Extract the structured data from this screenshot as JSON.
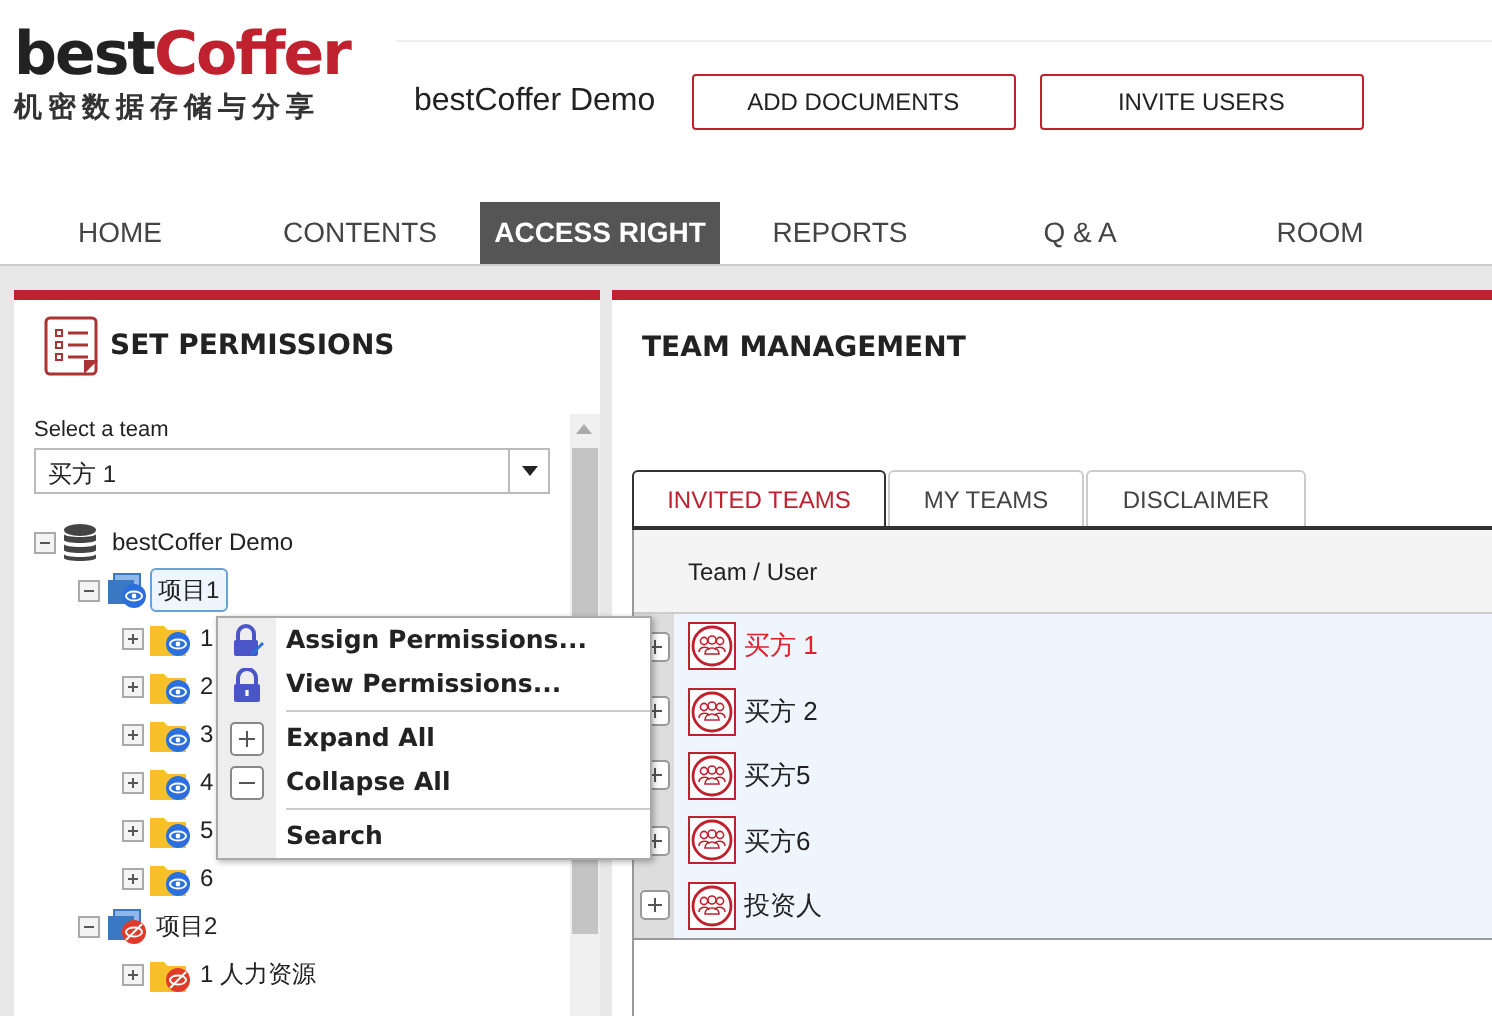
{
  "logo": {
    "brand_dark": "best",
    "brand_red": "Coffer",
    "tagline": "机密数据存储与分享"
  },
  "site_title": "bestCoffer Demo",
  "header_buttons": [
    "ADD DOCUMENTS",
    "INVITE USERS"
  ],
  "nav": [
    {
      "label": "HOME",
      "selected": false
    },
    {
      "label": "CONTENTS",
      "selected": false
    },
    {
      "label": "ACCESS RIGHT",
      "selected": true
    },
    {
      "label": "REPORTS",
      "selected": false
    },
    {
      "label": "Q & A",
      "selected": false
    },
    {
      "label": "ROOM",
      "selected": false
    }
  ],
  "left_panel": {
    "title": "SET PERMISSIONS",
    "team_select": {
      "label": "Select a team",
      "value": "买方 1"
    },
    "tree": [
      {
        "label": "bestCoffer Demo",
        "kind": "database",
        "expanded": true,
        "selected": false,
        "children": [
          {
            "label": "项目1",
            "kind": "project",
            "hidden": false,
            "expanded": true,
            "selected": true,
            "children": [
              {
                "label": "1",
                "kind": "folder",
                "hidden": false,
                "expanded": false,
                "selected": false
              },
              {
                "label": "2",
                "kind": "folder",
                "hidden": false,
                "expanded": false,
                "selected": false
              },
              {
                "label": "3",
                "kind": "folder",
                "hidden": false,
                "expanded": false,
                "selected": false
              },
              {
                "label": "4",
                "kind": "folder",
                "hidden": false,
                "expanded": false,
                "selected": false
              },
              {
                "label": "5",
                "kind": "folder",
                "hidden": false,
                "expanded": false,
                "selected": false
              },
              {
                "label": "6",
                "kind": "folder",
                "hidden": false,
                "expanded": false,
                "selected": false
              }
            ]
          },
          {
            "label": "项目2",
            "kind": "project",
            "hidden": true,
            "expanded": true,
            "selected": false,
            "children": [
              {
                "label": "1 人力资源",
                "kind": "folder",
                "hidden": true,
                "expanded": false,
                "selected": false
              }
            ]
          }
        ]
      }
    ]
  },
  "context_menu": [
    {
      "label": "Assign Permissions...",
      "kind": "assign",
      "divider_before": false
    },
    {
      "label": "View Permissions...",
      "kind": "view",
      "divider_before": false
    },
    {
      "label": "Expand All",
      "kind": "expand",
      "divider_before": true
    },
    {
      "label": "Collapse All",
      "kind": "collapse",
      "divider_before": false
    },
    {
      "label": "Search",
      "kind": "search",
      "divider_before": true
    }
  ],
  "right_panel": {
    "title": "TEAM MANAGEMENT",
    "tabs": [
      {
        "label": "INVITED TEAMS",
        "selected": true
      },
      {
        "label": "MY TEAMS",
        "selected": false
      },
      {
        "label": "DISCLAIMER",
        "selected": false
      }
    ],
    "table": {
      "columns": [
        "Team / User"
      ],
      "rows": [
        {
          "name": "买方 1",
          "selected": true
        },
        {
          "name": "买方 2",
          "selected": false
        },
        {
          "name": "买方5",
          "selected": false
        },
        {
          "name": "买方6",
          "selected": false
        },
        {
          "name": "投资人",
          "selected": false
        }
      ]
    }
  }
}
